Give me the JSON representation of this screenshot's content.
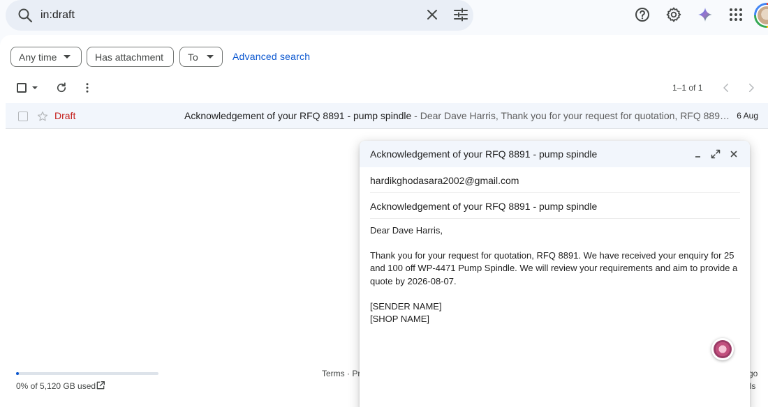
{
  "search": {
    "query": "in:draft"
  },
  "filters": {
    "any_time": "Any time",
    "has_attachment": "Has attachment",
    "to": "To",
    "advanced_search": "Advanced search"
  },
  "toolbar": {
    "pagination": "1–1 of 1"
  },
  "email_row": {
    "sender": "Draft",
    "subject": "Acknowledgement of your RFQ 8891 - pump spindle",
    "snippet": " - Dear Dave Harris, Thank you for your request for quotation, RFQ 889…",
    "date": "6 Aug"
  },
  "compose": {
    "title": "Acknowledgement of your RFQ 8891 - pump spindle",
    "to": "hardikghodasara2002@gmail.com",
    "subject": "Acknowledgement of your RFQ 8891 - pump spindle",
    "body": {
      "greeting": "Dear Dave Harris,",
      "paragraph": "Thank you for your request for quotation, RFQ 8891. We have received your enquiry for 25 and 100 off WP-4471 Pump Spindle. We will review your requirements and aim to provide a quote by 2026-08-07.",
      "sender_name": "[SENDER NAME]",
      "shop_name": "[SHOP NAME]"
    }
  },
  "footer": {
    "storage": "0% of 5,120 GB used",
    "storage_fraction": 0.02,
    "terms": "Terms · Pri",
    "right_line1": "go",
    "right_line2": "ils"
  },
  "colors": {
    "accent": "#0b57d0",
    "draft_red": "#c5221f",
    "search_bg": "#e9eef6"
  }
}
